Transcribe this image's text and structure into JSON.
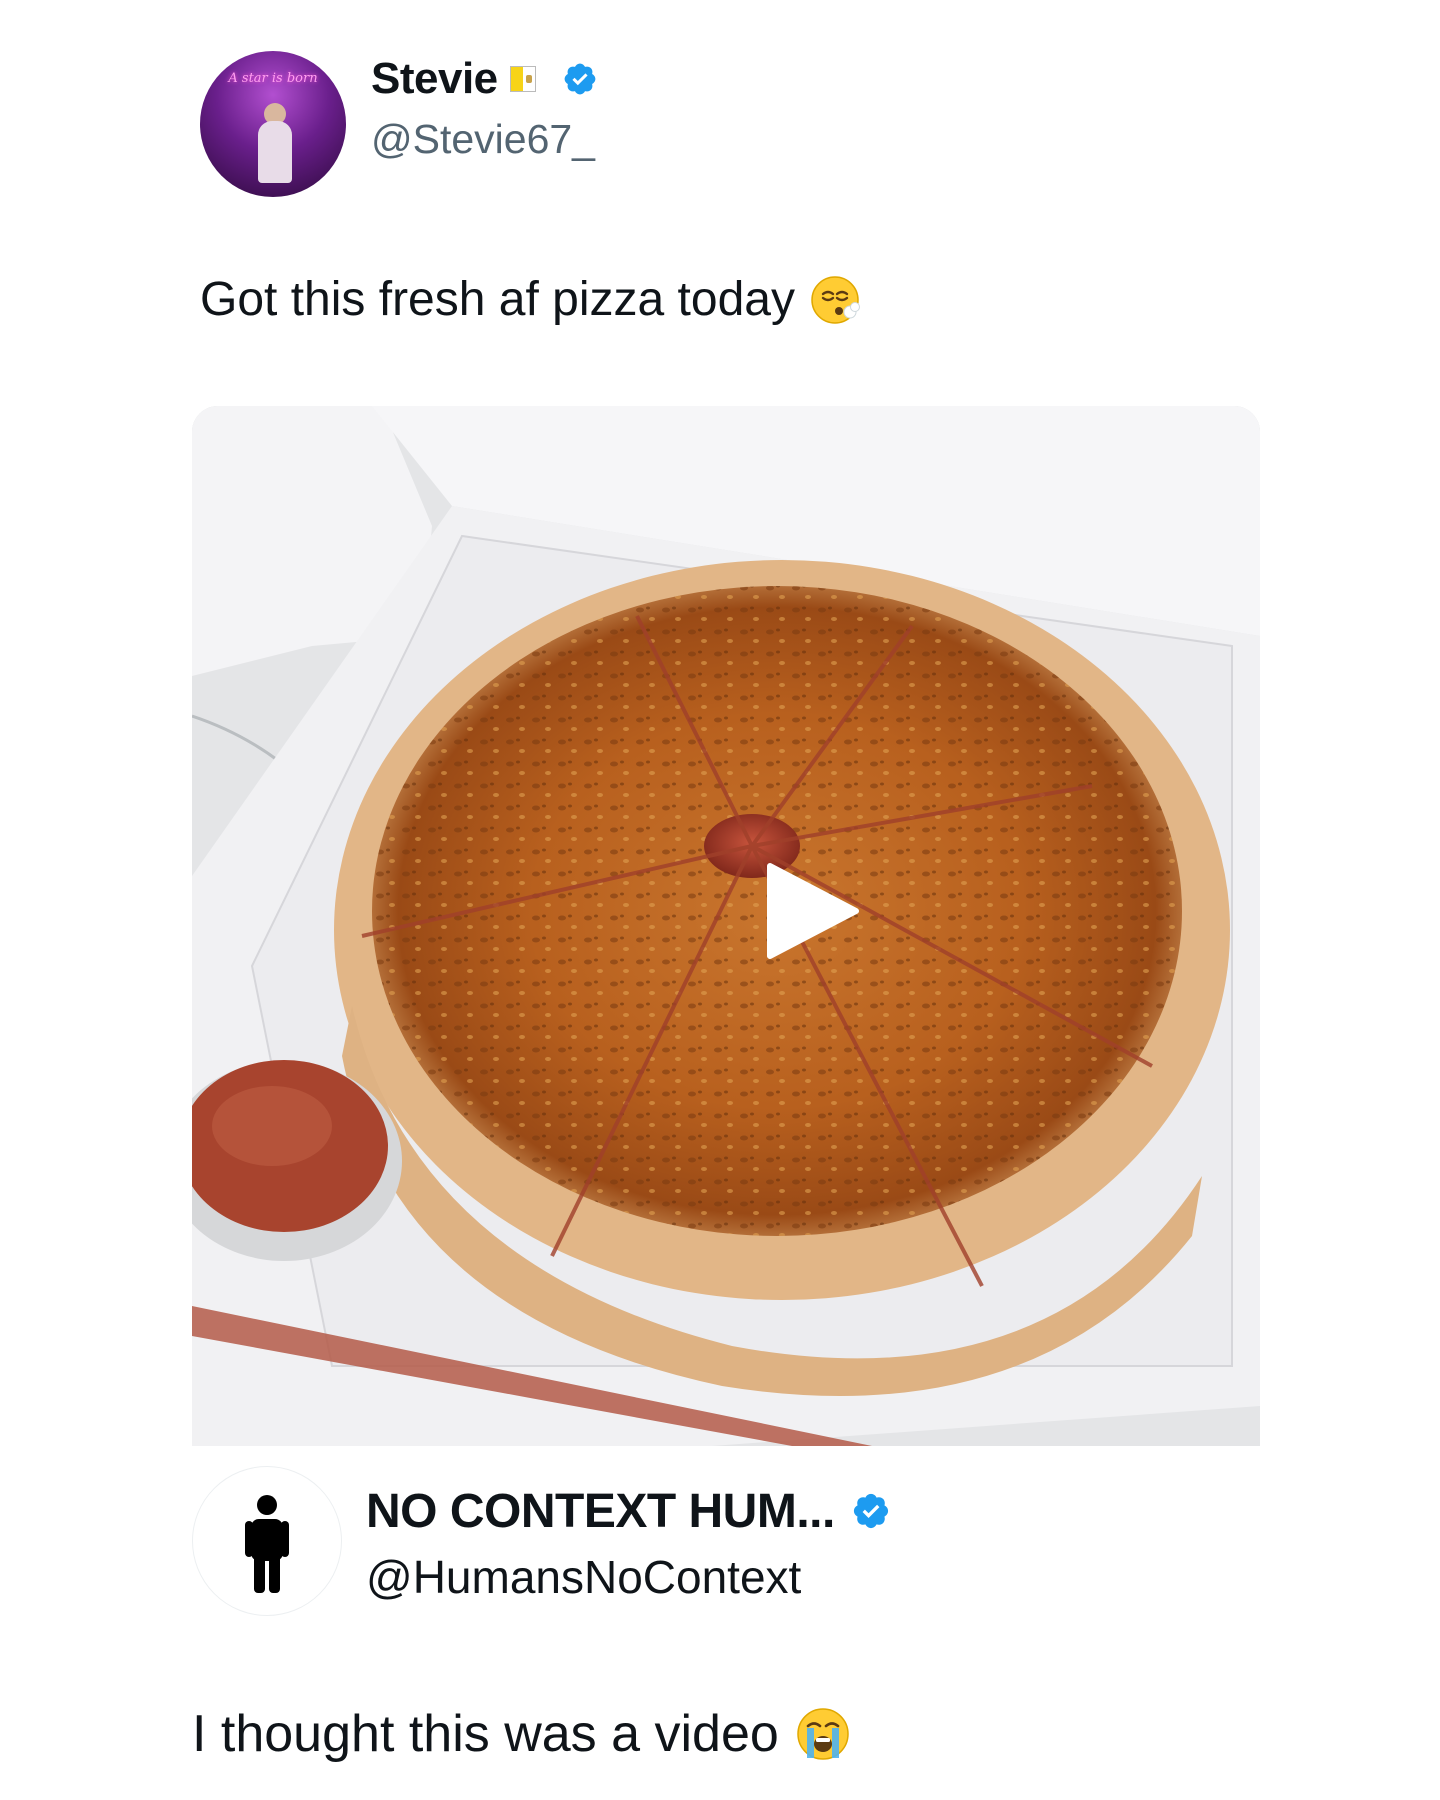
{
  "tweet": {
    "author": {
      "display_name": "Stevie",
      "handle": "@Stevie67_",
      "avatar_neon_text": "A star is born",
      "flag_icon": "vatican-flag-icon",
      "verified": true
    },
    "text": "Got this fresh af pizza today",
    "emoji_icon": "face-exhaling-emoji",
    "media": {
      "type": "image",
      "play_icon": "play-icon"
    }
  },
  "quote": {
    "author": {
      "display_name": "NO CONTEXT HUM...",
      "handle": "@HumansNoContext",
      "avatar_icon": "standing-person-icon",
      "verified": true
    },
    "text": "I thought this was a video",
    "emoji_icon": "loudly-crying-face-emoji"
  },
  "colors": {
    "verified_blue": "#1d9bf0",
    "text_primary": "#0f1419",
    "text_secondary": "#536471"
  }
}
